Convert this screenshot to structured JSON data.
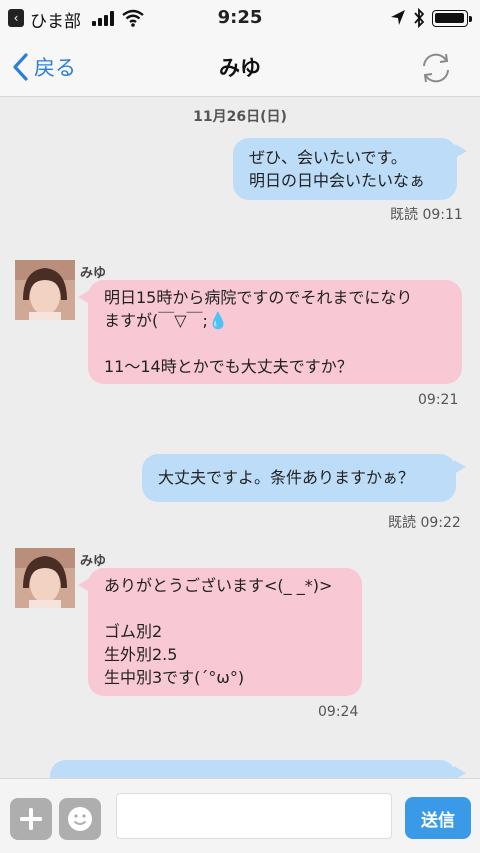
{
  "status_bar": {
    "back_app": "ひま部",
    "time": "9:25"
  },
  "nav": {
    "back_label": "戻る",
    "title": "みゆ"
  },
  "chat": {
    "date": "11月26日(日)",
    "messages": [
      {
        "direction": "out",
        "text": "ぜひ、会いたいです。\n明日の日中会いたいなぁ",
        "read": "既読",
        "time": "09:11"
      },
      {
        "direction": "in",
        "sender": "みゆ",
        "text": "明日15時から病院ですのでそれまでになり\nますが(￣▽￣;💧\n\n11〜14時とかでも大丈夫ですか？",
        "time": "09:21"
      },
      {
        "direction": "out",
        "text": "大丈夫ですよ。条件ありますかぁ？",
        "read": "既読",
        "time": "09:22"
      },
      {
        "direction": "in",
        "sender": "みゆ",
        "text": "ありがとうございます<(_ _*)>\n\nゴム別2\n生外別2.5\n生中別3です(´°ω°)",
        "time": "09:24"
      },
      {
        "direction": "out",
        "text": ""
      }
    ]
  },
  "input_bar": {
    "send_label": "送信",
    "placeholder": ""
  },
  "colors": {
    "outgoing_bubble": "#bcdcf8",
    "incoming_bubble": "#f8c8d4",
    "accent": "#2b7fd8",
    "send_button": "#3a9ae8"
  }
}
